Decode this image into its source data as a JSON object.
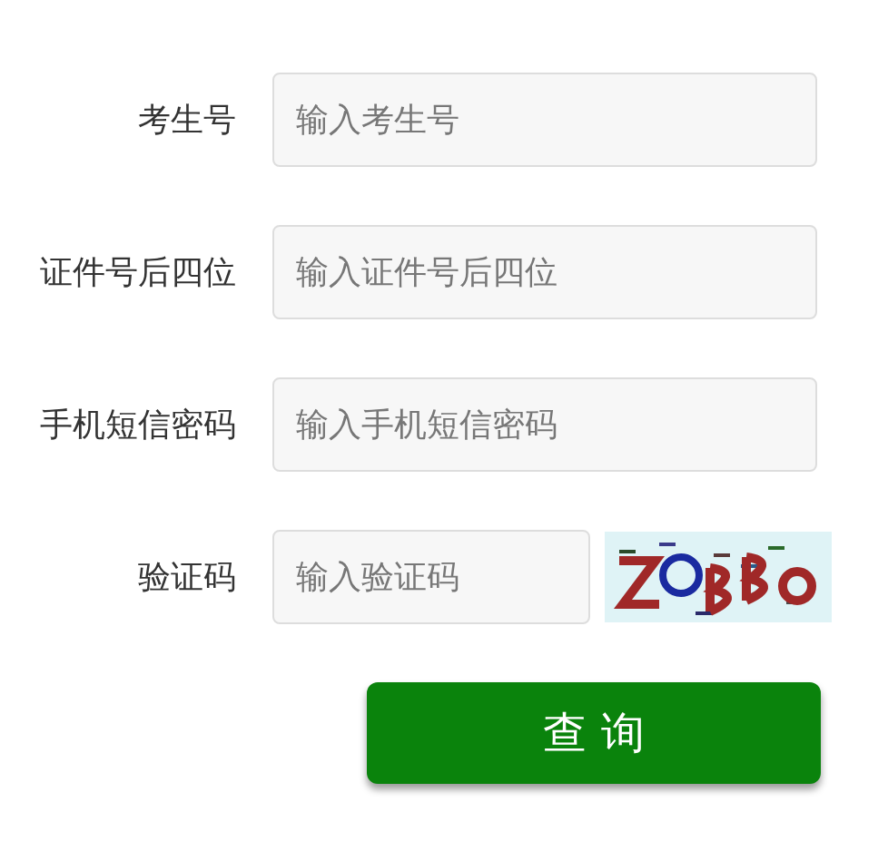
{
  "fields": [
    {
      "kind": "text",
      "label": "考生号",
      "placeholder": "输入考生号"
    },
    {
      "kind": "text",
      "label": "证件号后四位",
      "placeholder": "输入证件号后四位"
    },
    {
      "kind": "text",
      "label": "手机短信密码",
      "placeholder": "输入手机短信密码"
    },
    {
      "kind": "captcha",
      "label": "验证码",
      "placeholder": "输入验证码"
    }
  ],
  "submit": "查 询"
}
